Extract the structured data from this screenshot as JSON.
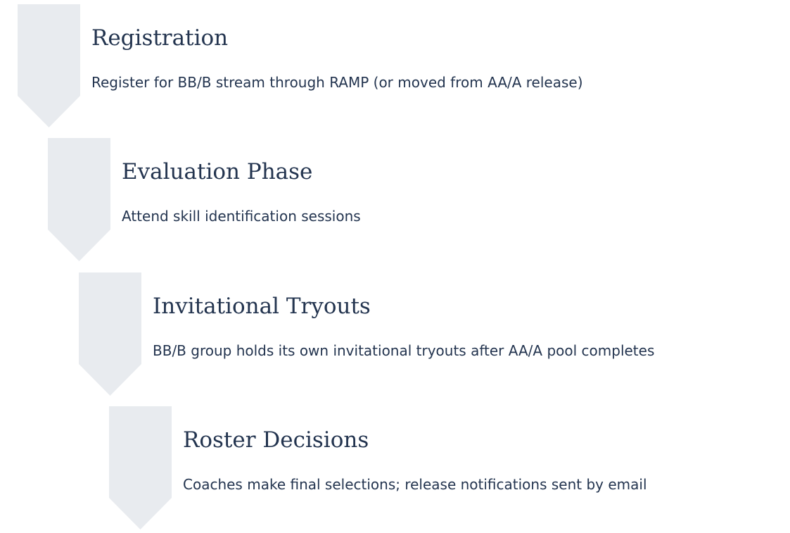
{
  "colors": {
    "arrow_fill": "#e8ebef",
    "text": "#23344f",
    "background": "#ffffff"
  },
  "steps": [
    {
      "icon": "down-arrow-icon",
      "title": "Registration",
      "description": "Register for BB/B stream through RAMP (or moved from AA/A release)"
    },
    {
      "icon": "down-arrow-icon",
      "title": "Evaluation Phase",
      "description": "Attend skill identification sessions"
    },
    {
      "icon": "down-arrow-icon",
      "title": "Invitational Tryouts",
      "description": "BB/B group holds its own invitational tryouts after AA/A pool completes"
    },
    {
      "icon": "down-arrow-icon",
      "title": "Roster Decisions",
      "description": "Coaches make final selections; release notifications sent by email"
    }
  ]
}
